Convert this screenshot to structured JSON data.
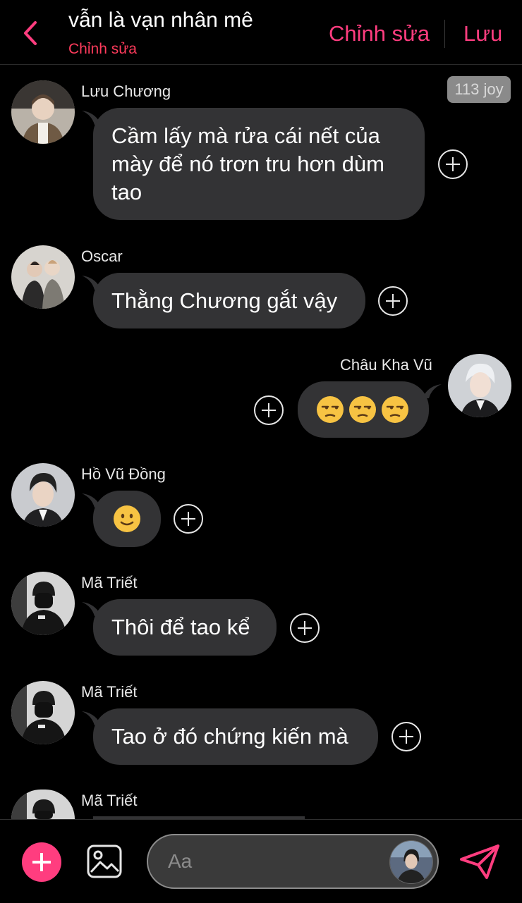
{
  "header": {
    "title": "vẫn là vạn nhân mê",
    "subtitle": "Chỉnh sửa",
    "edit_label": "Chỉnh sửa",
    "save_label": "Lưu",
    "accent_color": "#ff3d7f"
  },
  "badge": "113 joy",
  "messages": [
    {
      "sender": "Lưu Chương",
      "text": "Cầm lấy mà rửa cái nết của mày để nó trơn tru hơn dùm tao",
      "side": "left"
    },
    {
      "sender": "Oscar",
      "text": "Thằng Chương gắt vậy",
      "side": "left"
    },
    {
      "sender": "Châu Kha Vũ",
      "emoji": "unamused-face x3",
      "side": "right"
    },
    {
      "sender": "Hồ Vũ Đồng",
      "emoji": "slightly-smiling-face",
      "side": "left"
    },
    {
      "sender": "Mã Triết",
      "text": "Thôi để tao kể",
      "side": "left"
    },
    {
      "sender": "Mã Triết",
      "text": "Tao ở đó chứng kiến mà",
      "side": "left"
    },
    {
      "sender": "Mã Triết",
      "text": "",
      "side": "left"
    }
  ],
  "composer": {
    "placeholder": "Aa"
  },
  "icons": {
    "back": "chevron-left-icon",
    "add": "plus-icon",
    "image": "image-icon",
    "send": "send-icon"
  }
}
